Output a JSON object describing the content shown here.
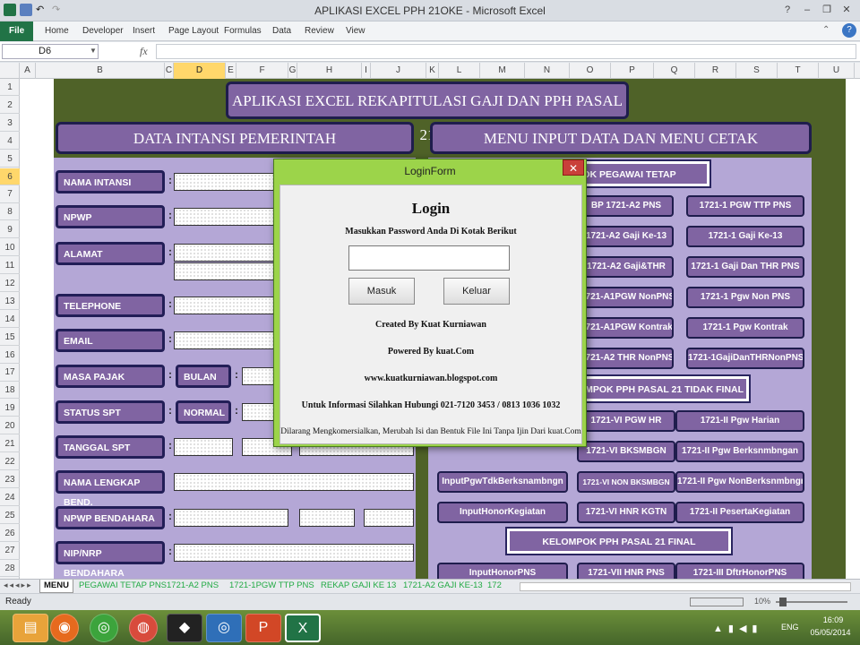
{
  "window": {
    "title": "APLIKASI EXCEL PPH 21OKE - Microsoft Excel",
    "help": "?",
    "min": "–",
    "max": "❐",
    "close": "✕"
  },
  "ribbon": {
    "tabs": [
      "File",
      "Home",
      "Developer",
      "Insert",
      "Page Layout",
      "Formulas",
      "Data",
      "Review",
      "View"
    ]
  },
  "formula": {
    "name_box": "D6",
    "fx": "fx",
    "value": ""
  },
  "columns": [
    "A",
    "B",
    "C",
    "D",
    "E",
    "F",
    "G",
    "H",
    "I",
    "J",
    "K",
    "L",
    "M",
    "N",
    "O",
    "P",
    "Q",
    "R",
    "S",
    "T",
    "U"
  ],
  "selected_column": "D",
  "rows": [
    "1",
    "2",
    "3",
    "4",
    "5",
    "6",
    "7",
    "8",
    "9",
    "10",
    "11",
    "12",
    "13",
    "14",
    "15",
    "16",
    "17",
    "18",
    "19",
    "20",
    "21",
    "22",
    "23",
    "24",
    "25",
    "26",
    "27",
    "28"
  ],
  "selected_row": "6",
  "sheet": {
    "app_title": "APLIKASI EXCEL REKAPITULASI GAJI DAN PPH PASAL 21",
    "left_header": "DATA INTANSI PEMERINTAH",
    "right_header": "MENU INPUT DATA DAN MENU CETAK",
    "labels": [
      "NAMA INTANSI",
      "NPWP",
      "ALAMAT",
      "TELEPHONE",
      "EMAIL",
      "MASA PAJAK",
      "STATUS SPT",
      "TANGGAL SPT",
      "NAMA  LENGKAP BEND.",
      "NPWP BENDAHARA",
      "NIP/NRP BENDAHARA"
    ],
    "colon": ":",
    "bulan": "BULAN",
    "normal": "NORMAL",
    "section_tetap": "KELOMPOK PEGAWAI TETAP",
    "section_tidak_final": "KELOMPOK PPH PASAL 21 TIDAK FINAL",
    "section_final": "KELOMPOK PPH PASAL 21 FINAL",
    "buttons_mid": [
      "BP 1721-A2 PNS",
      "1721-A2 Gaji Ke-13",
      "1721-A2 Gaji&THR",
      "1721-A1PGW NonPNS",
      "1721-A1PGW Kontrak",
      "1721-A2 THR NonPNS"
    ],
    "buttons_right": [
      "1721-1 PGW TTP PNS",
      "1721-1 Gaji Ke-13",
      "1721-1 Gaji Dan THR PNS",
      "1721-1 Pgw Non PNS",
      "1721-1 Pgw Kontrak",
      "1721-1GajiDanTHRNonPNS"
    ],
    "tf_left": [
      "InputPgwTdkBerksnambngn",
      "InputHonorKegiatan"
    ],
    "tf_mid": [
      "1721-VI PGW HR",
      "1721-VI BKSMBGN",
      "1721-VI NON BKSMBGN",
      "1721-VI HNR KGTN"
    ],
    "tf_right": [
      "1721-II Pgw Harian",
      "1721-II Pgw Berksnmbngan",
      "1721-II Pgw NonBerksnmbngn",
      "1721-II PesertaKegiatan"
    ],
    "final_buttons": [
      "InputHonorPNS",
      "1721-VII HNR PNS",
      "1721-III DftrHonorPNS"
    ]
  },
  "sheet_tabs": [
    "MENU",
    "PEGAWAI TETAP PNS",
    "1721-A2 PNS",
    "1721-1PGW TTP PNS",
    "REKAP GAJI KE 13",
    "1721-A2 GAJI KE-13",
    "172"
  ],
  "status": {
    "ready": "Ready",
    "zoom": "10%"
  },
  "taskbar": {
    "lang": "ENG",
    "time": "16:09",
    "date": "05/05/2014"
  },
  "dialog": {
    "title": "LoginForm",
    "heading": "Login",
    "instruction": "Masukkan Password Anda Di Kotak Berikut",
    "password_value": "",
    "masuk": "Masuk",
    "keluar": "Keluar",
    "created": "Created By Kuat Kurniawan",
    "powered": "Powered By kuat.Com",
    "website": "www.kuatkurniawan.blogspot.com",
    "info": "Untuk Informasi Silahkan Hubungi 021-7120 3453 / 0813 1036 1032",
    "disclaimer": "Dilarang Mengkomersialkan, Merubah Isi dan Bentuk File Ini Tanpa Ijin Dari kuat.Com"
  },
  "colors": {
    "accent": "#217346",
    "purple": "#8064a2",
    "green_bg": "#4f6228",
    "dialog": "#9cd44a"
  }
}
